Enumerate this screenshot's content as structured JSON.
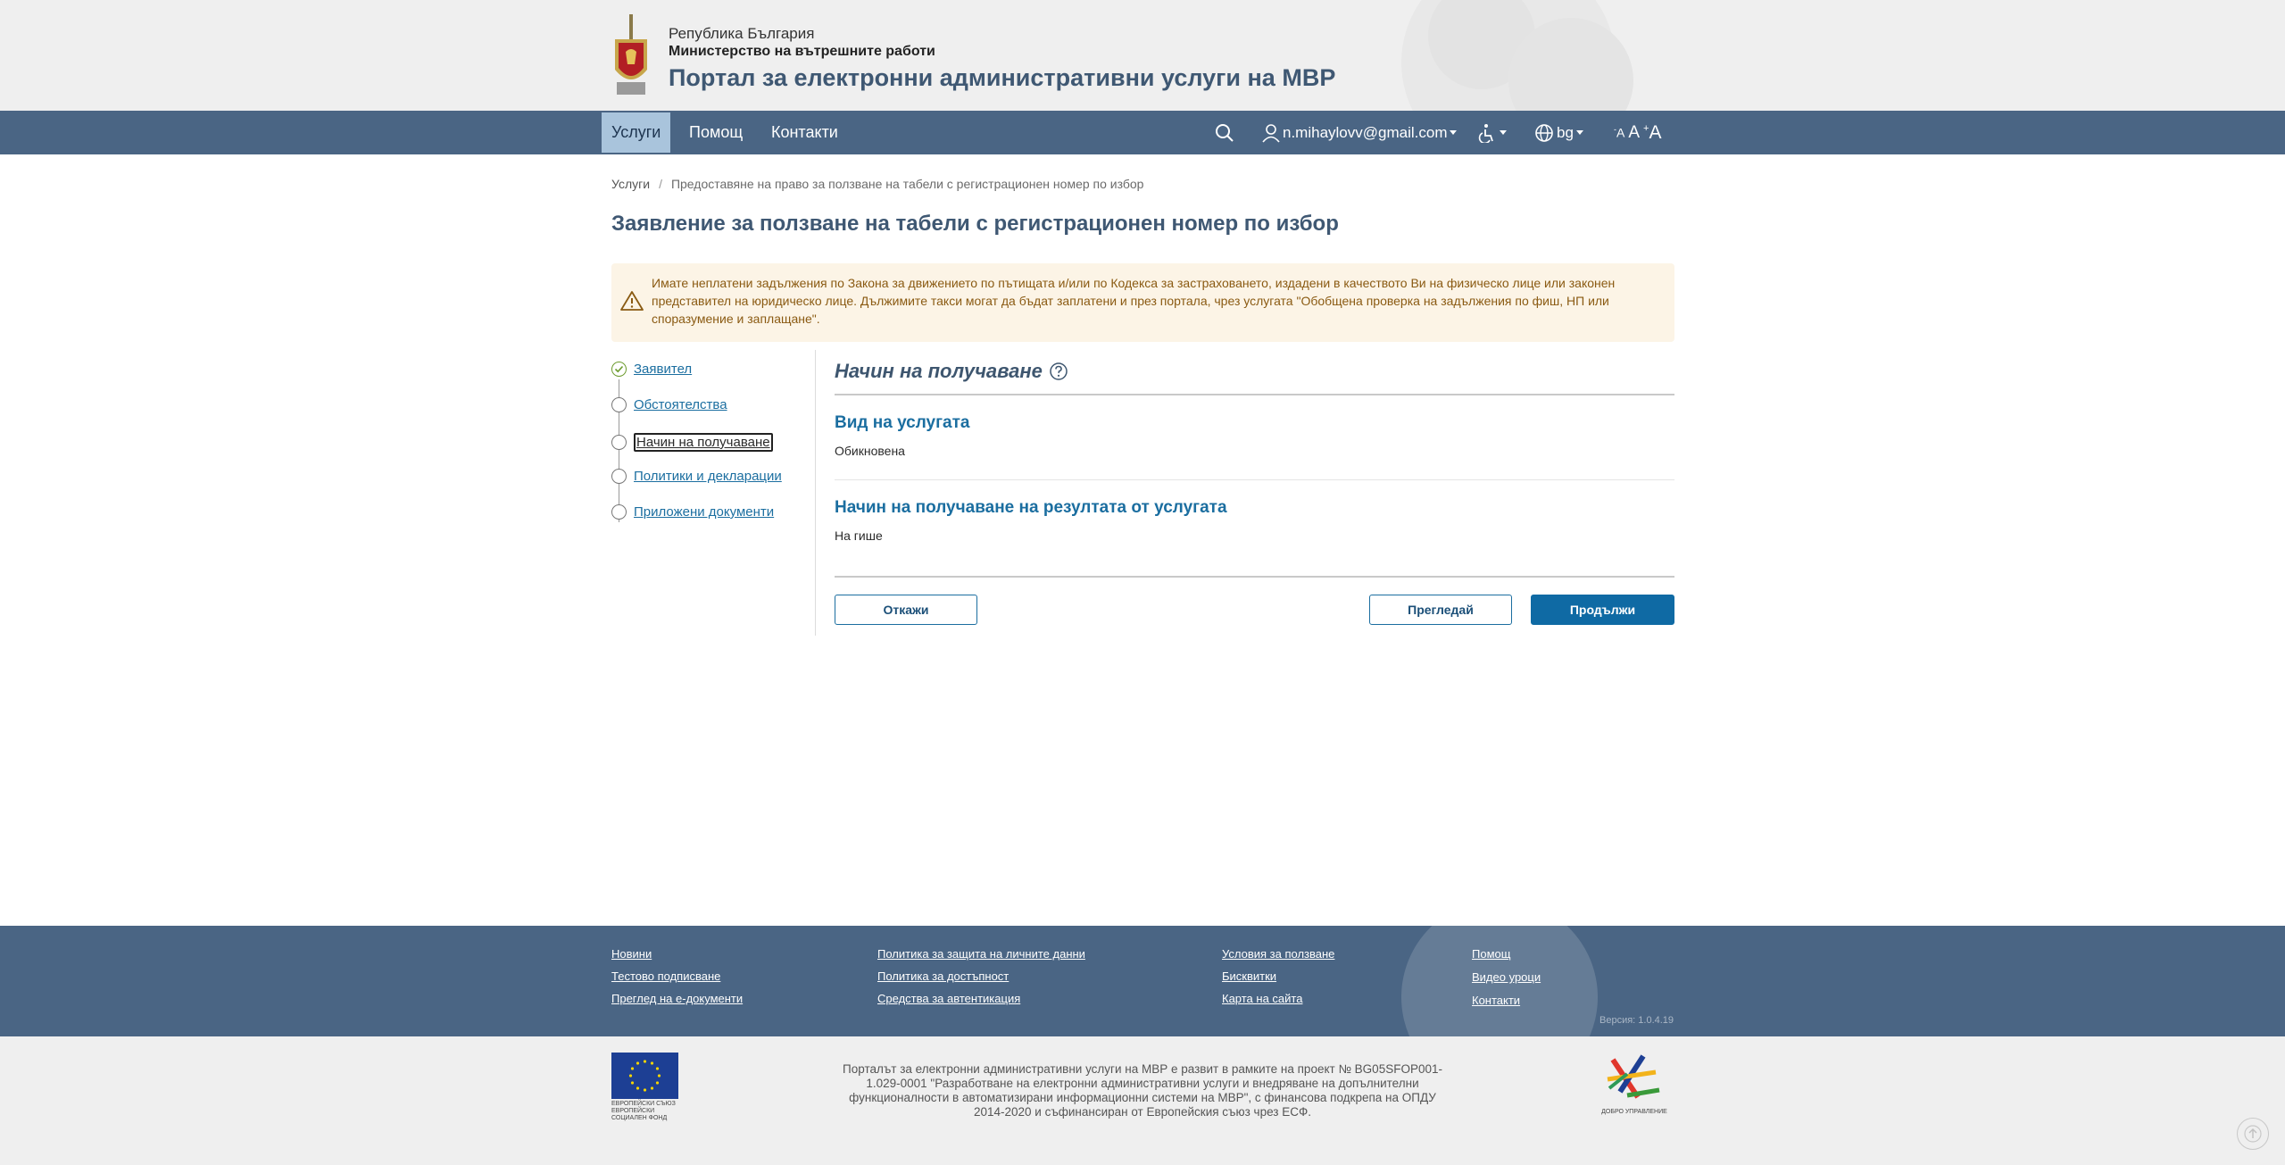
{
  "header": {
    "line1": "Република България",
    "line2": "Министерство на вътрешните работи",
    "line3": "Портал за електронни административни услуги на МВР"
  },
  "nav": {
    "items": [
      "Услуги",
      "Помощ",
      "Контакти"
    ],
    "active": "Услуги",
    "user_email": "n.mihaylovv@gmail.com",
    "language": "bg",
    "font_small": "A",
    "font_medium": "A",
    "font_large": "A",
    "font_small_mark": "-",
    "font_large_mark": "+"
  },
  "breadcrumb": {
    "home": "Услуги",
    "separator": "/",
    "current": "Предоставяне на право за ползване на табели с регистрационен номер по избор"
  },
  "page_title": "Заявление за ползване на табели с регистрационен номер по избор",
  "alert": {
    "text": "Имате неплатени задължения по Закона за движението по пътищата и/или по Кодекса за застраховането, издадени в качеството Ви на физическо лице или законен представител на юридическо лице. Дължимите такси могат да бъдат заплатени и през портала, чрез услугата \"Обобщена проверка на задължения по фиш, НП или споразумение и заплащане\"."
  },
  "steps": [
    {
      "label": "Заявител",
      "state": "done"
    },
    {
      "label": "Обстоятелства",
      "state": "pending"
    },
    {
      "label": "Начин на получаване",
      "state": "current"
    },
    {
      "label": "Политики и декларации",
      "state": "pending"
    },
    {
      "label": "Приложени документи",
      "state": "pending"
    }
  ],
  "form": {
    "section_title": "Начин на получаване",
    "service_type_label": "Вид на услугата",
    "service_type_value": "Обикновена",
    "delivery_label": "Начин на получаване на резултата от услугата",
    "delivery_value": "На гише"
  },
  "buttons": {
    "cancel": "Откажи",
    "preview": "Прегледай",
    "continue": "Продължи"
  },
  "footer": {
    "col1": [
      "Новини",
      "Тестово подписване",
      "Преглед на е-документи"
    ],
    "col2": [
      "Политика за защита на личните данни",
      "Политика за достъпност",
      "Средства за автентикация"
    ],
    "col3": [
      "Условия за ползване",
      "Бисквитки",
      "Карта на сайта"
    ],
    "col4": [
      "Помощ",
      "Видео уроци",
      "Контакти"
    ],
    "version": "Версия: 1.0.4.19"
  },
  "subfooter": {
    "eu_label": "ЕВРОПЕЙСКИ СЪЮЗ ЕВРОПЕЙСКИ СОЦИАЛЕН ФОНД",
    "project_text": "Порталът за електронни административни услуги на МВР е развит в рамките на проект № BG05SFOP001-1.029-0001 \"Разработване на електронни административни услуги и внедряване на допълнителни функционалности в автоматизирани информационни системи на МВР\", с финансова подкрепа на ОПДУ 2014-2020 и съфинансиран от Европейския съюз чрез ЕСФ.",
    "good_gov_label": "ДОБРО УПРАВЛЕНИЕ"
  },
  "colors": {
    "nav_bg": "#4a6584",
    "accent": "#1b6ea0",
    "primary_button": "#0f6aa4",
    "alert_bg": "#fcf4e6",
    "alert_text": "#8a5a12"
  }
}
